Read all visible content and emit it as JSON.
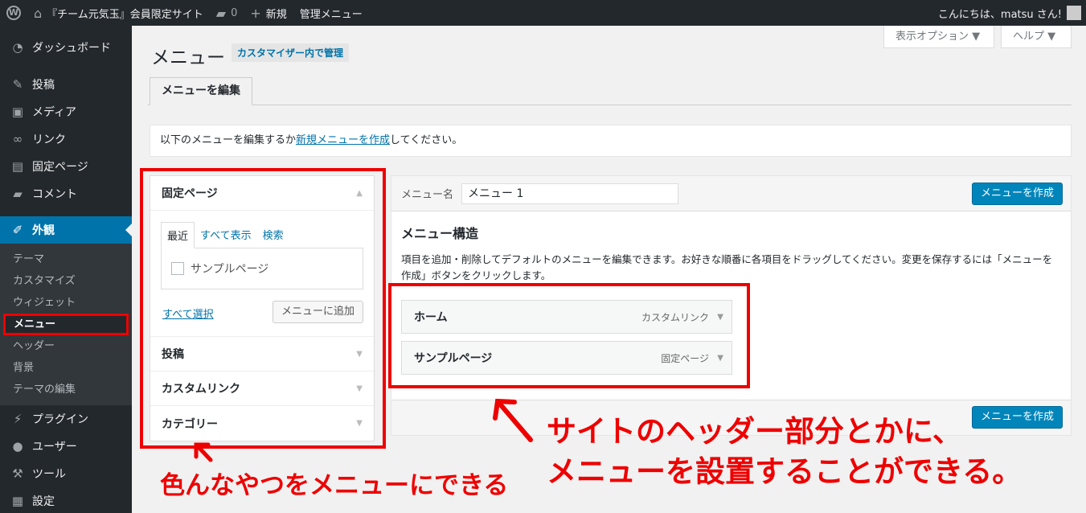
{
  "adminbar": {
    "site_name": "『チーム元気玉』会員限定サイト",
    "comments_count": "0",
    "new_label": "新規",
    "admin_menu_label": "管理メニュー",
    "greeting": "こんにちは、matsu さん!"
  },
  "sidebar": {
    "items": [
      {
        "icon": "dashboard-icon",
        "label": "ダッシュボード"
      },
      {
        "icon": "pin-icon",
        "label": "投稿"
      },
      {
        "icon": "media-icon",
        "label": "メディア"
      },
      {
        "icon": "link-icon",
        "label": "リンク"
      },
      {
        "icon": "pages-icon",
        "label": "固定ページ"
      },
      {
        "icon": "comment-icon",
        "label": "コメント"
      },
      {
        "icon": "brush-icon",
        "label": "外観"
      },
      {
        "icon": "plugin-icon",
        "label": "プラグイン"
      },
      {
        "icon": "user-icon",
        "label": "ユーザー"
      },
      {
        "icon": "wrench-icon",
        "label": "ツール"
      },
      {
        "icon": "settings-icon",
        "label": "設定"
      }
    ],
    "submenu": [
      "テーマ",
      "カスタマイズ",
      "ウィジェット",
      "メニュー",
      "ヘッダー",
      "背景",
      "テーマの編集"
    ]
  },
  "screen_options": "表示オプション ▼",
  "help": "ヘルプ ▼",
  "page_title": "メニュー",
  "title_action": "カスタマイザー内で管理",
  "nav_tab": "メニューを編集",
  "notice": {
    "prefix": "以下のメニューを編集するか",
    "link": "新規メニューを作成",
    "suffix": "してください。"
  },
  "accordion": {
    "open_section": "固定ページ",
    "tabs": [
      "最近",
      "すべて表示",
      "検索"
    ],
    "page_item": "サンプルページ",
    "select_all": "すべて選択",
    "add_button": "メニューに追加",
    "sections": [
      "投稿",
      "カスタムリンク",
      "カテゴリー"
    ]
  },
  "menu_editor": {
    "name_label": "メニュー名",
    "name_value": "メニュー 1",
    "create_button": "メニューを作成",
    "structure_title": "メニュー構造",
    "structure_desc": "項目を追加・削除してデフォルトのメニューを編集できます。お好きな順番に各項目をドラッグしてください。変更を保存するには「メニューを作成」ボタンをクリックします。",
    "items": [
      {
        "title": "ホーム",
        "type": "カスタムリンク"
      },
      {
        "title": "サンプルページ",
        "type": "固定ページ"
      }
    ]
  },
  "annotations": {
    "left": "色んなやつをメニューにできる",
    "right_line1": "サイトのヘッダー部分とかに、",
    "right_line2": "メニューを設置することができる。"
  },
  "colors": {
    "accent": "#0073aa",
    "annotation_red": "#e00000",
    "primary_button": "#0085ba"
  }
}
